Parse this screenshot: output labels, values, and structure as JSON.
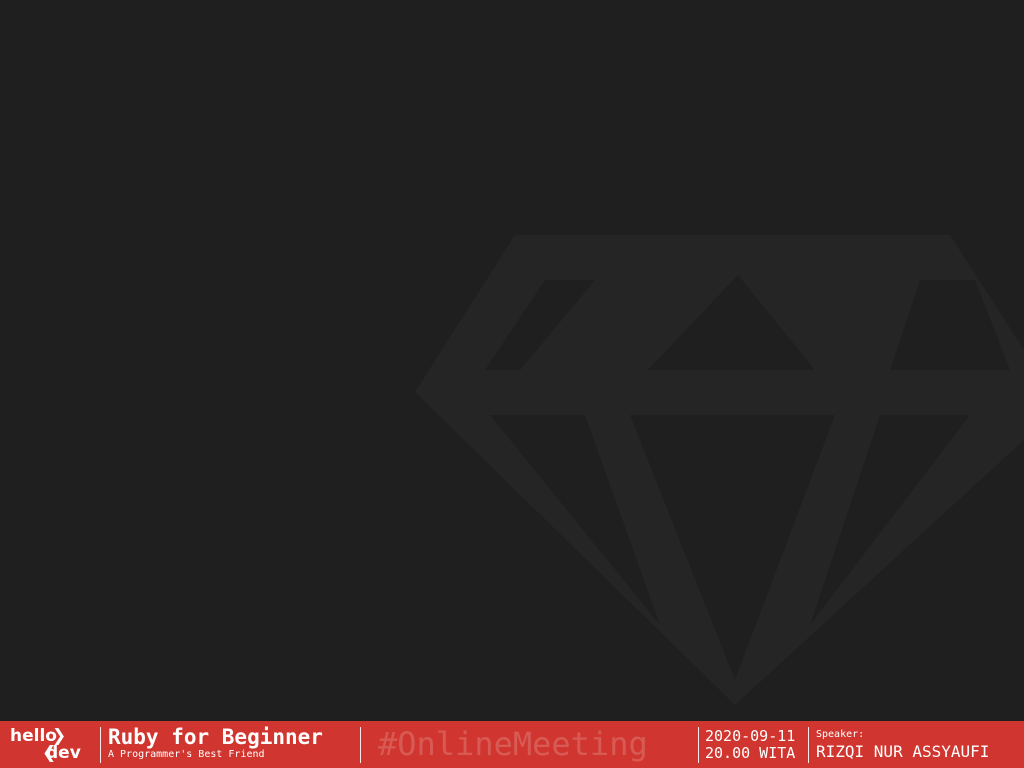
{
  "colors": {
    "background": "#1f1f1f",
    "watermark": "#262626",
    "bar": "#d0362f",
    "text": "#ffffff"
  },
  "logo": {
    "top_text": "hello",
    "bottom_text": "dev",
    "chevron_right": "❯",
    "chevron_left": "❮"
  },
  "event": {
    "title": "Ruby for Beginner",
    "subtitle": "A Programmer's Best Friend",
    "hashtag": "#OnlineMeeting",
    "date": "2020-09-11",
    "time": "20.00 WITA"
  },
  "speaker": {
    "label": "Speaker:",
    "name": "RIZQI NUR ASSYAUFI"
  },
  "icons": {
    "watermark": "ruby-gem-icon",
    "logo": "hello-dev-logo"
  }
}
